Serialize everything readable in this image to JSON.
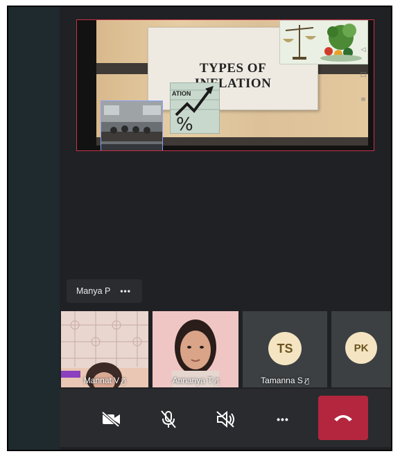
{
  "slide": {
    "title_line1": "TYPES OF",
    "title_line2": "INFLATION",
    "inset_text": "ATION",
    "percent_symbol": "%"
  },
  "pinned": {
    "name": "Manya P",
    "more": "•••"
  },
  "tiles": [
    {
      "name": "Mannat V",
      "kind": "video",
      "mic": "muted"
    },
    {
      "name": "Annanya T",
      "kind": "video",
      "mic": "muted"
    },
    {
      "name": "Tamanna S",
      "kind": "avatar",
      "initials": "TS",
      "mic": "muted"
    },
    {
      "name": "",
      "kind": "avatar",
      "initials": "PK"
    }
  ],
  "controls": {
    "camera": "video-off-icon",
    "mic": "mic-off-icon",
    "speaker": "speaker-off-icon",
    "more": "•••",
    "end_call": "hang-up-icon"
  },
  "colors": {
    "background": "#202124",
    "tile": "#3c4043",
    "avatar_fill": "#f4e4c1",
    "avatar_text": "#6b5320",
    "end_call": "#b3263e",
    "share_border": "#c8314b"
  }
}
